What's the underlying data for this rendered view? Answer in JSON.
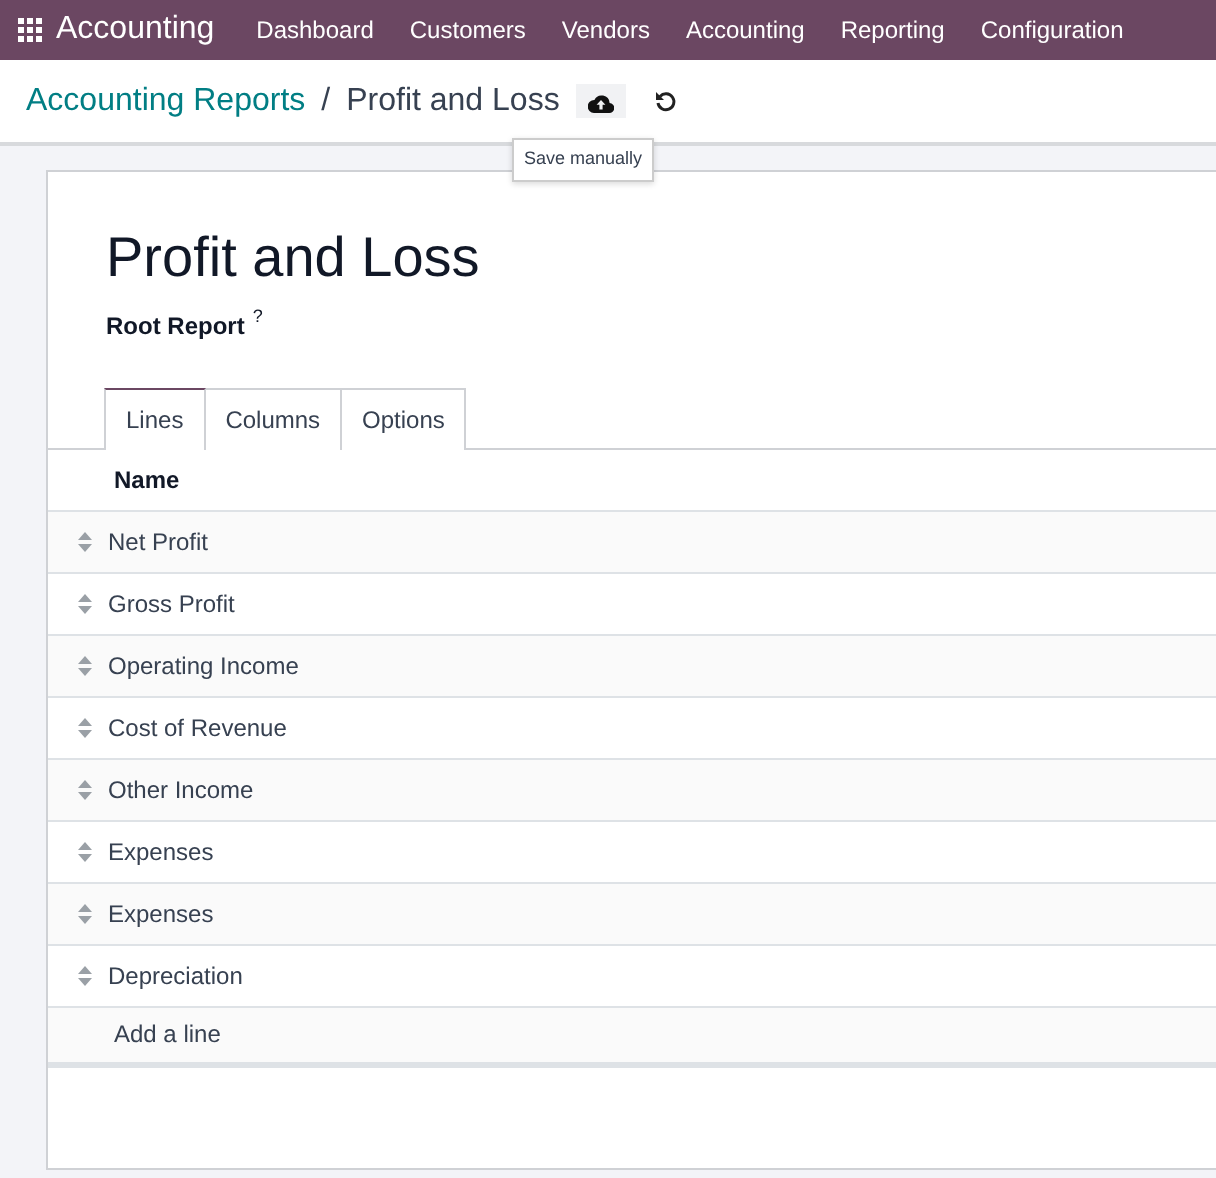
{
  "navbar": {
    "app": "Accounting",
    "menu": [
      "Dashboard",
      "Customers",
      "Vendors",
      "Accounting",
      "Reporting",
      "Configuration"
    ]
  },
  "breadcrumb": {
    "parent": "Accounting Reports",
    "separator": "/",
    "current": "Profit and Loss"
  },
  "tooltip": "Save manually",
  "form": {
    "title": "Profit and Loss",
    "subtitle": "Root Report",
    "help_mark": "?"
  },
  "tabs": [
    {
      "label": "Lines",
      "selected": true
    },
    {
      "label": "Columns",
      "selected": false
    },
    {
      "label": "Options",
      "selected": false
    }
  ],
  "table": {
    "columns": [
      "Name"
    ],
    "rows": [
      "Net Profit",
      "Gross Profit",
      "Operating Income",
      "Cost of Revenue",
      "Other Income",
      "Expenses",
      "Expenses",
      "Depreciation"
    ],
    "add_line": "Add a line"
  }
}
